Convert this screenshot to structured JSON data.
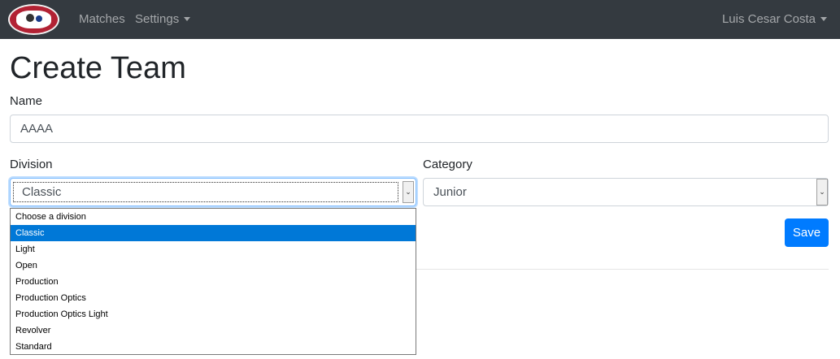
{
  "navbar": {
    "logo": "club-logo",
    "links": [
      "Matches",
      "Settings"
    ],
    "user": "Luis Cesar Costa"
  },
  "page": {
    "title": "Create Team"
  },
  "form": {
    "name_label": "Name",
    "name_value": "AAAA",
    "division_label": "Division",
    "division_value": "Classic",
    "division_options": [
      "Choose a division",
      "Classic",
      "Light",
      "Open",
      "Production",
      "Production Optics",
      "Production Optics Light",
      "Revolver",
      "Standard"
    ],
    "division_selected_index": 1,
    "category_label": "Category",
    "category_value": "Junior",
    "save_label": "Save"
  },
  "colors": {
    "navbar": "#343a40",
    "primary": "#007bff",
    "option_highlight": "#0078d7"
  }
}
